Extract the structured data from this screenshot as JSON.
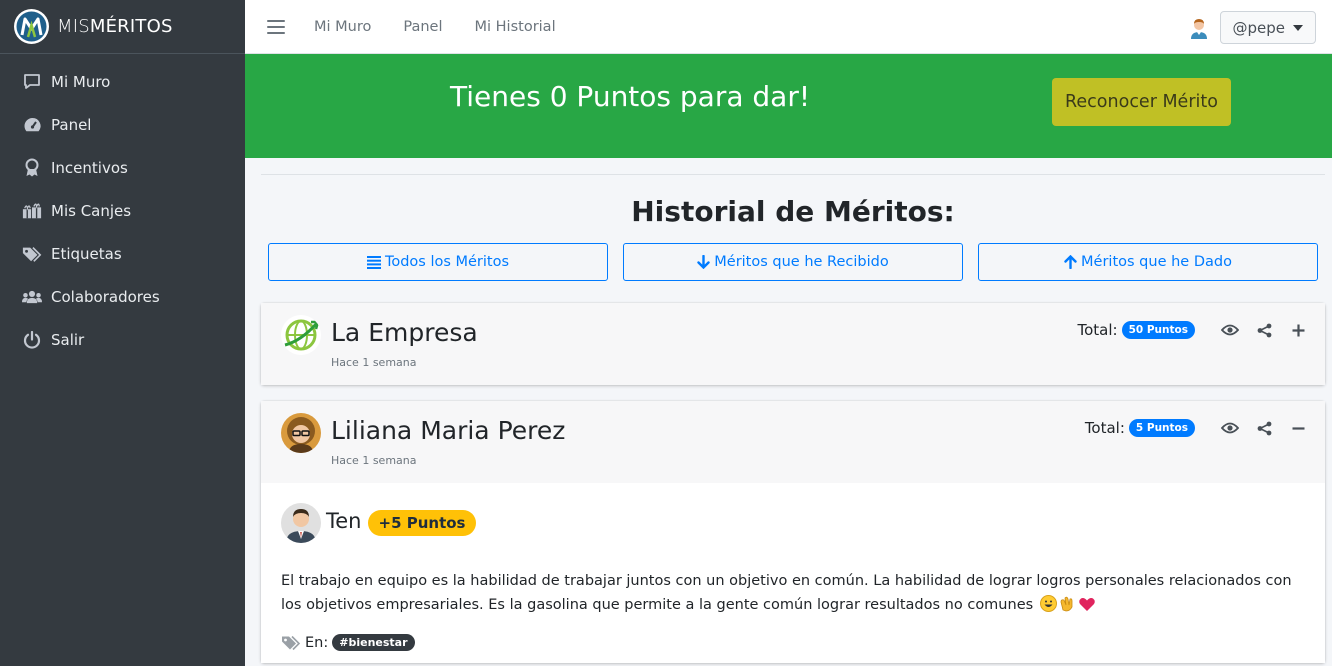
{
  "brand": {
    "prefix": "MIS",
    "name": "MÉRITOS"
  },
  "sidebar": {
    "items": [
      {
        "label": "Mi Muro",
        "icon": "comment-icon"
      },
      {
        "label": "Panel",
        "icon": "gauge-icon"
      },
      {
        "label": "Incentivos",
        "icon": "award-icon"
      },
      {
        "label": "Mis Canjes",
        "icon": "gifts-icon"
      },
      {
        "label": "Etiquetas",
        "icon": "tags-icon"
      },
      {
        "label": "Colaboradores",
        "icon": "users-icon"
      },
      {
        "label": "Salir",
        "icon": "power-icon"
      }
    ]
  },
  "topbar": {
    "links": [
      "Mi Muro",
      "Panel",
      "Mi Historial"
    ],
    "user": "@pepe"
  },
  "banner": {
    "title": "Tienes 0 Puntos para dar!",
    "button": "Reconocer Mérito",
    "color": "#28a745",
    "button_color": "#c0c025"
  },
  "history": {
    "title": "Historial de Méritos:",
    "filters": [
      "Todos los Méritos",
      "Méritos que he Recibido",
      "Méritos que he Dado"
    ]
  },
  "cards": [
    {
      "name": "La Empresa",
      "time": "Hace 1 semana",
      "total_label": "Total:",
      "points": "50 Puntos",
      "expand_icon": "plus-icon"
    },
    {
      "name": "Liliana Maria Perez",
      "time": "Hace 1 semana",
      "total_label": "Total:",
      "points": "5 Puntos",
      "expand_icon": "minus-icon",
      "merit": {
        "giver": "Ten",
        "points": "+5 Puntos",
        "message": "El trabajo en equipo es la habilidad de trabajar juntos con un objetivo en común. La habilidad de lograr logros personales relacionados con los objetivos empresariales. Es la gasolina que permite a la gente común lograr resultados no comunes",
        "tags_label": "En:",
        "tag": "#bienestar"
      }
    }
  ]
}
